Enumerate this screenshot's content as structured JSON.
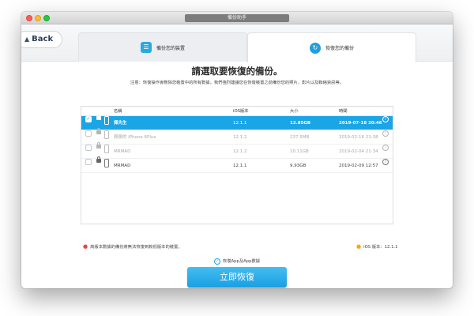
{
  "window": {
    "title": "備份助手"
  },
  "nav": {
    "back_label": "Back",
    "back_icon": "chevron-up-icon"
  },
  "tabs": [
    {
      "label": "備份您的裝置",
      "icon": "backup-list-icon",
      "active": false
    },
    {
      "label": "恢復您的備份",
      "icon": "restore-clock-icon",
      "active": true
    }
  ],
  "main": {
    "heading": "請選取要恢復的備份。",
    "notice": "注意：恢復操作會刪除您裝置中的所有數據，我們強烈建議您在恢復裝置之前備份您的照片，影片以及聯絡資訊等。"
  },
  "table": {
    "headers": {
      "name": "名稱",
      "version": "iOS版本",
      "size": "大小",
      "time": "時間"
    },
    "rows": [
      {
        "name": "佩先生",
        "version": "12.1.1",
        "size": "12.85GB",
        "time": "2019-07-18 20:46",
        "checked": true,
        "state": "selected"
      },
      {
        "name": "佩佩的 iPhone 6Plus",
        "version": "12.1.2",
        "size": "237.5MB",
        "time": "2019-02-16 21:38",
        "checked": false,
        "state": "disabled"
      },
      {
        "name": "MRMAD",
        "version": "12.1.2",
        "size": "10.11GB",
        "time": "2019-02-04 21:34",
        "checked": false,
        "state": "disabled"
      },
      {
        "name": "MRMAD",
        "version": "12.1.1",
        "size": "9.93GB",
        "time": "2019-02-09 12:57",
        "checked": false,
        "state": "normal"
      }
    ]
  },
  "footer": {
    "warning": "高版本數據的備份將無法恢復到較低版本的裝置。",
    "ios_version": "iOS 版本：12.1.1",
    "option_label": "恢復App及App數據",
    "restore_button": "立即恢復"
  },
  "colors": {
    "accent": "#1aa5e6",
    "warning_dot": "#ee4444",
    "info_dot": "#f5a623"
  }
}
